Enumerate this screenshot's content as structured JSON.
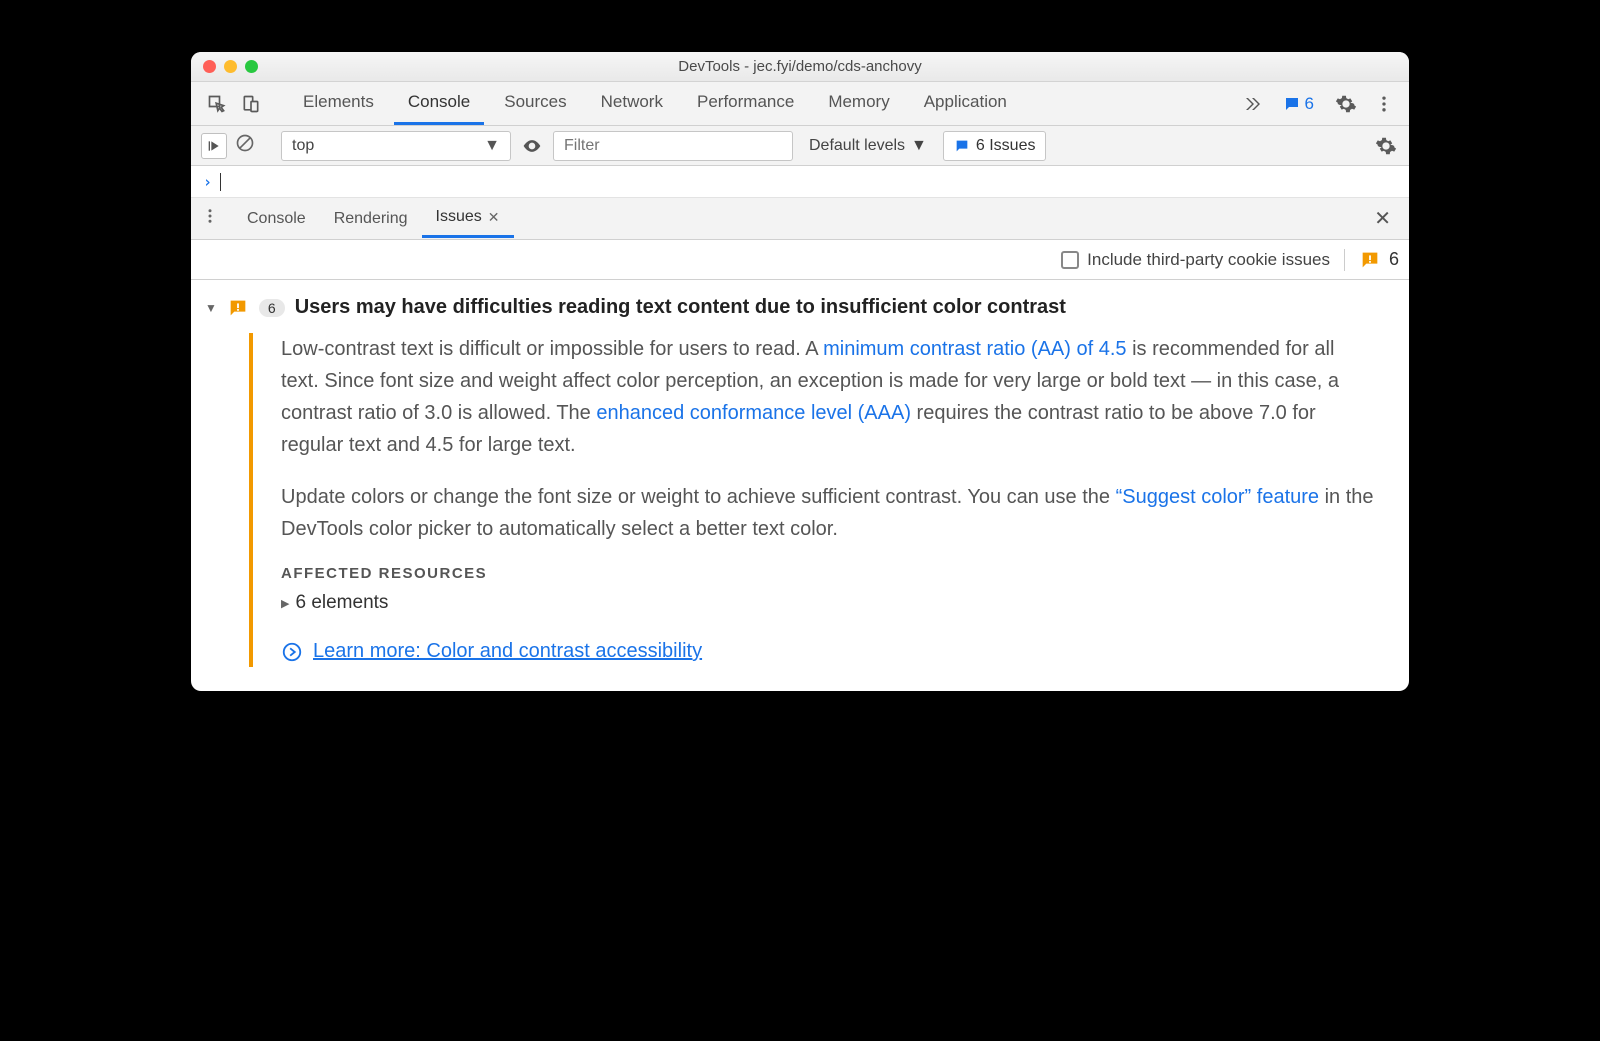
{
  "window": {
    "title": "DevTools - jec.fyi/demo/cds-anchovy"
  },
  "mainTabs": {
    "items": [
      "Elements",
      "Console",
      "Sources",
      "Network",
      "Performance",
      "Memory",
      "Application"
    ],
    "activeIndex": 1,
    "issuesBadgeCount": "6"
  },
  "consoleBar": {
    "context": "top",
    "filterPlaceholder": "Filter",
    "levelsLabel": "Default levels",
    "issuesBtnLabel": "6 Issues"
  },
  "drawer": {
    "tabs": [
      "Console",
      "Rendering",
      "Issues"
    ],
    "activeIndex": 2,
    "thirdPartyLabel": "Include third-party cookie issues",
    "warnCount": "6"
  },
  "issue": {
    "count": "6",
    "title": "Users may have difficulties reading text content due to insufficient color contrast",
    "para1_a": "Low-contrast text is difficult or impossible for users to read. A ",
    "link1": "minimum contrast ratio (AA) of 4.5",
    "para1_b": " is recommended for all text. Since font size and weight affect color perception, an exception is made for very large or bold text — in this case, a contrast ratio of 3.0 is allowed. The ",
    "link2": "enhanced conformance level (AAA)",
    "para1_c": " requires the contrast ratio to be above 7.0 for regular text and 4.5 for large text.",
    "para2_a": "Update colors or change the font size or weight to achieve sufficient contrast. You can use the ",
    "link3": "“Suggest color” feature",
    "para2_b": " in the DevTools color picker to automatically select a better text color.",
    "affectedLabel": "AFFECTED RESOURCES",
    "elementsLine": "6 elements",
    "learnMore": "Learn more: Color and contrast accessibility"
  }
}
